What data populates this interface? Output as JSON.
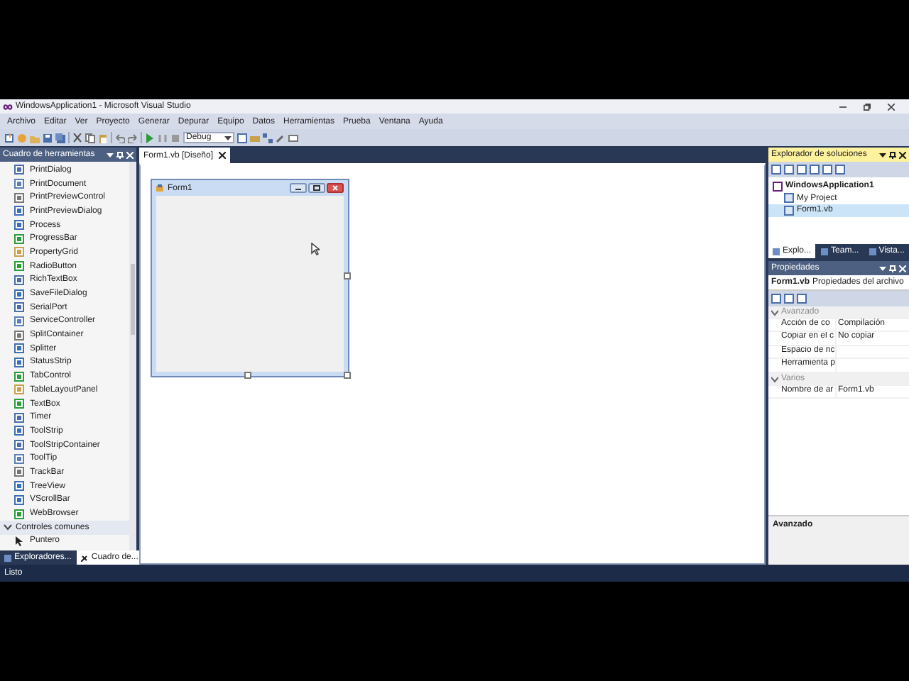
{
  "window": {
    "title": "WindowsApplication1 - Microsoft Visual Studio"
  },
  "menu": [
    "Archivo",
    "Editar",
    "Ver",
    "Proyecto",
    "Generar",
    "Depurar",
    "Equipo",
    "Datos",
    "Herramientas",
    "Prueba",
    "Ventana",
    "Ayuda"
  ],
  "toolbar": {
    "configuration": "Debug"
  },
  "toolbox": {
    "title": "Cuadro de herramientas",
    "items": [
      "PrintDialog",
      "PrintDocument",
      "PrintPreviewControl",
      "PrintPreviewDialog",
      "Process",
      "ProgressBar",
      "PropertyGrid",
      "RadioButton",
      "RichTextBox",
      "SaveFileDialog",
      "SerialPort",
      "ServiceController",
      "SplitContainer",
      "Splitter",
      "StatusStrip",
      "TabControl",
      "TableLayoutPanel",
      "TextBox",
      "Timer",
      "ToolStrip",
      "ToolStripContainer",
      "ToolTip",
      "TrackBar",
      "TreeView",
      "VScrollBar",
      "WebBrowser"
    ],
    "groups": [
      {
        "label": "Controles comunes",
        "expanded": true,
        "items": [
          "Puntero"
        ]
      }
    ]
  },
  "left_tabs": [
    {
      "label": "Exploradores...",
      "selected": false
    },
    {
      "label": "Cuadro de...",
      "selected": true
    }
  ],
  "document_tabs": [
    {
      "label": "Form1.vb [Diseño]",
      "selected": true
    }
  ],
  "form": {
    "title": "Form1"
  },
  "solution_explorer": {
    "title": "Explorador de soluciones",
    "tree": [
      {
        "label": "WindowsApplication1",
        "selected": false,
        "children": [
          {
            "label": "My Project",
            "selected": false
          },
          {
            "label": "Form1.vb",
            "selected": true
          }
        ]
      }
    ]
  },
  "right_tabs": [
    {
      "label": "Explo...",
      "selected": true
    },
    {
      "label": "Team...",
      "selected": false
    },
    {
      "label": "Vista...",
      "selected": false
    }
  ],
  "properties": {
    "title": "Propiedades",
    "object": "Form1.vb",
    "object_type": "Propiedades del archivo",
    "categories": [
      {
        "label": "Avanzado",
        "expanded": true,
        "rows": [
          {
            "name": "Acción de co",
            "value": "Compilación"
          },
          {
            "name": "Copiar en el c",
            "value": "No copiar"
          },
          {
            "name": "Espacio de nc",
            "value": ""
          },
          {
            "name": "Herramienta p",
            "value": ""
          }
        ]
      },
      {
        "label": "Varios",
        "expanded": true,
        "rows": [
          {
            "name": "Nombre de ar",
            "value": "Form1.vb"
          }
        ]
      }
    ],
    "description": "Avanzado"
  },
  "status_bar": {
    "text": "Listo"
  }
}
